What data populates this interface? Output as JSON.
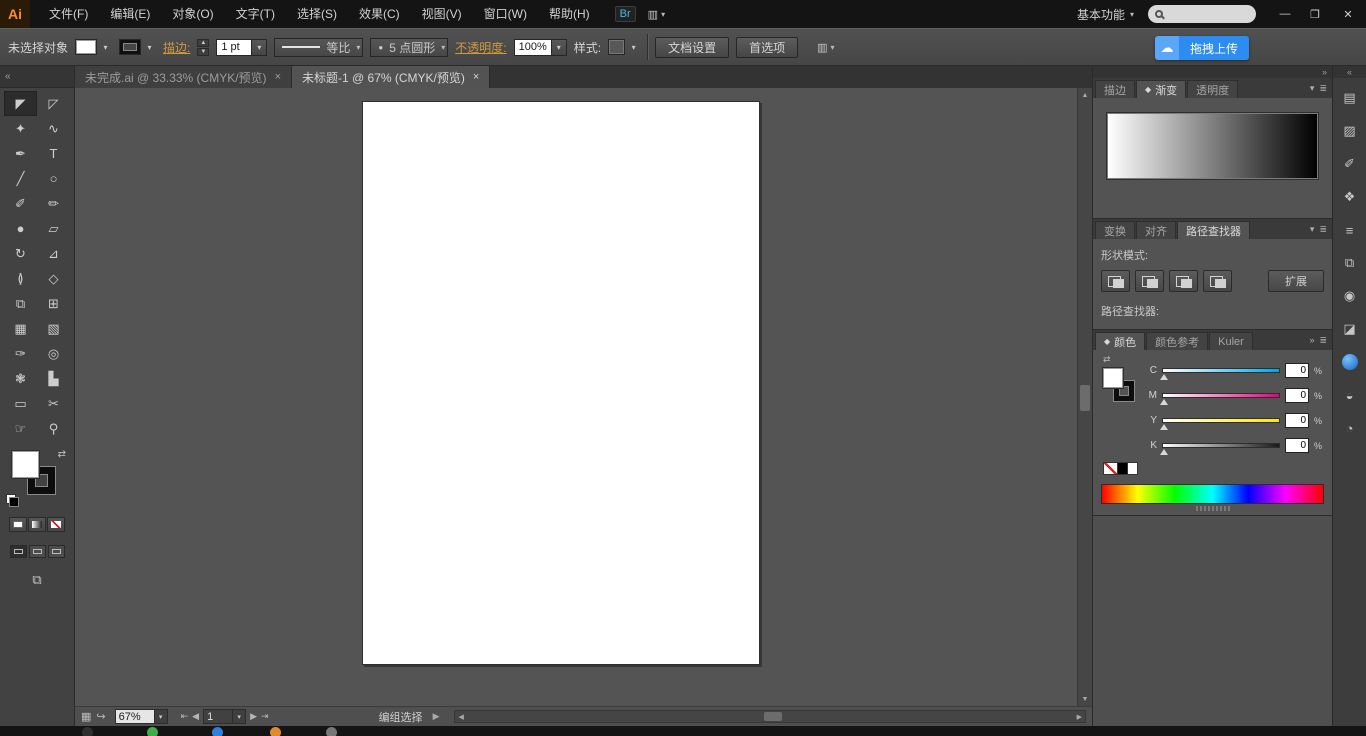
{
  "colors": {
    "accent_blue": "#2d8cf0",
    "logo_orange": "#ff8b2b",
    "cyan": "#00a6e8",
    "magenta": "#e5007e",
    "yellow": "#ffe600"
  },
  "icons": {
    "collapse_left": "«",
    "collapse_right": "»",
    "panel_menu": "≣",
    "dropdown": "▾",
    "up": "▲",
    "down": "▼",
    "left": "◀",
    "right": "▶",
    "first": "⇤",
    "last": "⇥",
    "close": "✕",
    "minimize": "—",
    "restore": "❐",
    "swap": "⇄",
    "tab_marker": "◆",
    "bullet": "●",
    "cloud": "☁",
    "arrange": "▥",
    "status_nav": "▦",
    "status_flow": "↪",
    "screen_mode": "⧉"
  },
  "menubar": {
    "logo": "Ai",
    "items": [
      "文件(F)",
      "编辑(E)",
      "对象(O)",
      "文字(T)",
      "选择(S)",
      "效果(C)",
      "视图(V)",
      "窗口(W)",
      "帮助(H)"
    ],
    "bridge": "Br",
    "workspace": "基本功能"
  },
  "controlbar": {
    "status": "未选择对象",
    "stroke_label": "描边:",
    "stroke_value": "1 pt",
    "profile_value": "等比",
    "brush_value": "5 点圆形",
    "opacity_label": "不透明度:",
    "opacity_value": "100%",
    "style_label": "样式:",
    "doc_setup": "文档设置",
    "preferences": "首选项",
    "upload_label": "拖拽上传"
  },
  "tabs": [
    {
      "title": "未完成.ai @ 33.33% (CMYK/预览)",
      "close": "×"
    },
    {
      "title": "未标题-1 @ 67% (CMYK/预览)",
      "close": "×"
    }
  ],
  "toolbar": {
    "tools": [
      {
        "name": "selection-tool",
        "glyph": "◤"
      },
      {
        "name": "direct-selection-tool",
        "glyph": "◸"
      },
      {
        "name": "magic-wand-tool",
        "glyph": "✦"
      },
      {
        "name": "lasso-tool",
        "glyph": "∿"
      },
      {
        "name": "pen-tool",
        "glyph": "✒"
      },
      {
        "name": "type-tool",
        "glyph": "T"
      },
      {
        "name": "line-segment-tool",
        "glyph": "╱"
      },
      {
        "name": "ellipse-tool",
        "glyph": "○"
      },
      {
        "name": "paintbrush-tool",
        "glyph": "✐"
      },
      {
        "name": "pencil-tool",
        "glyph": "✏"
      },
      {
        "name": "blob-brush-tool",
        "glyph": "●"
      },
      {
        "name": "eraser-tool",
        "glyph": "▱"
      },
      {
        "name": "rotate-tool",
        "glyph": "↻"
      },
      {
        "name": "scale-tool",
        "glyph": "⊿"
      },
      {
        "name": "width-tool",
        "glyph": "≬"
      },
      {
        "name": "free-transform-tool",
        "glyph": "◇"
      },
      {
        "name": "shape-builder-tool",
        "glyph": "⧉"
      },
      {
        "name": "perspective-grid-tool",
        "glyph": "⊞"
      },
      {
        "name": "mesh-tool",
        "glyph": "▦"
      },
      {
        "name": "gradient-tool",
        "glyph": "▧"
      },
      {
        "name": "eyedropper-tool",
        "glyph": "✑"
      },
      {
        "name": "blend-tool",
        "glyph": "◎"
      },
      {
        "name": "symbol-sprayer-tool",
        "glyph": "❃"
      },
      {
        "name": "column-graph-tool",
        "glyph": "▙"
      },
      {
        "name": "artboard-tool",
        "glyph": "▭"
      },
      {
        "name": "slice-tool",
        "glyph": "✂"
      },
      {
        "name": "hand-tool",
        "glyph": "☞"
      },
      {
        "name": "zoom-tool",
        "glyph": "⚲"
      }
    ]
  },
  "panels": {
    "gradient_group": {
      "tabs": [
        "描边",
        "渐变",
        "透明度"
      ]
    },
    "pathfinder_group": {
      "tabs": [
        "变换",
        "对齐",
        "路径查找器"
      ],
      "shape_modes_label": "形状模式:",
      "expand_button": "扩展",
      "pathfinders_label": "路径查找器:"
    },
    "color_group": {
      "tabs": [
        "颜色",
        "颜色参考",
        "Kuler"
      ],
      "sliders": [
        {
          "label": "C",
          "value": "0",
          "unit": "%"
        },
        {
          "label": "M",
          "value": "0",
          "unit": "%"
        },
        {
          "label": "Y",
          "value": "0",
          "unit": "%"
        },
        {
          "label": "K",
          "value": "0",
          "unit": "%"
        }
      ]
    }
  },
  "dock": {
    "icons": [
      {
        "name": "cc-libraries-icon",
        "glyph": "▤"
      },
      {
        "name": "swatches-icon",
        "glyph": "▨"
      },
      {
        "name": "brushes-icon",
        "glyph": "✐"
      },
      {
        "name": "symbols-icon",
        "glyph": "❖"
      },
      {
        "name": "layers-icon",
        "glyph": "≡"
      },
      {
        "name": "artboards-icon",
        "glyph": "⧉"
      },
      {
        "name": "appearance-icon",
        "glyph": "◉"
      },
      {
        "name": "graphic-styles-icon",
        "glyph": "◪"
      },
      {
        "name": "kuler-icon",
        "glyph": ""
      },
      {
        "name": "stroke-panel-icon",
        "glyph": "◒"
      },
      {
        "name": "info-icon",
        "glyph": "◔"
      }
    ]
  },
  "statusbar": {
    "zoom": "67%",
    "artboard": "1",
    "status": "编组选择"
  }
}
